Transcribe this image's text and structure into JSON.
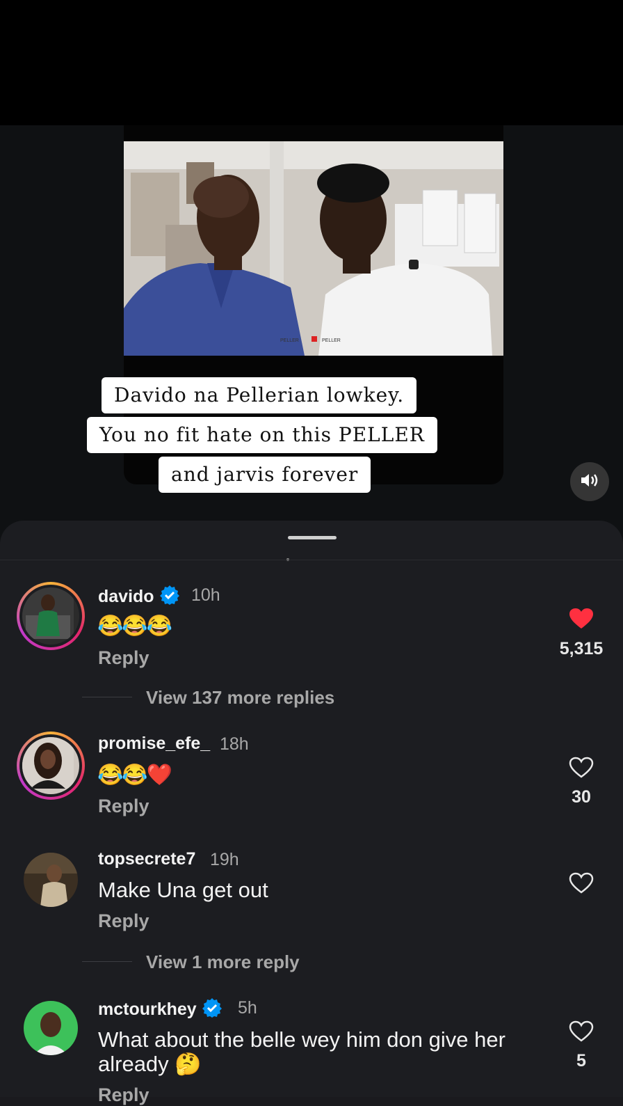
{
  "video": {
    "overlay_lines": [
      "Davido na Pellerian lowkey.",
      "You no fit hate on this PELLER",
      "and jarvis forever"
    ],
    "frame_labels": [
      "PELLER",
      "PELLER"
    ]
  },
  "comments": [
    {
      "username": "davido",
      "verified": true,
      "time": "10h",
      "text": "😂😂😂",
      "reply_label": "Reply",
      "likes": "5,315",
      "liked": true,
      "view_more": "View 137 more replies"
    },
    {
      "username": "promise_efe_",
      "verified": false,
      "time": "18h",
      "text": "😂😂❤️",
      "reply_label": "Reply",
      "likes": "30",
      "liked": false
    },
    {
      "username": "topsecrete7",
      "verified": false,
      "time": "19h",
      "text": "Make Una get out",
      "reply_label": "Reply",
      "likes": "",
      "liked": false,
      "view_more": "View 1 more reply"
    },
    {
      "username": "mctourkhey",
      "verified": true,
      "time": "5h",
      "text_line1": "What about the belle wey him don give her",
      "text_line2": "already 🤔",
      "reply_label": "Reply",
      "likes": "5",
      "liked": false
    }
  ],
  "colors": {
    "like_red": "#ff3040",
    "verified_blue": "#0095f6"
  }
}
